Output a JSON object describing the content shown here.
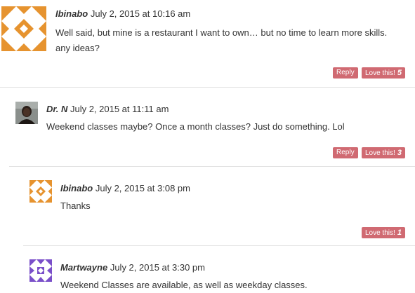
{
  "comments": [
    {
      "author": "Ibinabo",
      "date": "July 2, 2015 at 10:16 am",
      "text": "Well said, but mine is a restaurant I want to own… but no time to learn more skills. any ideas?",
      "reply_label": "Reply",
      "love_label": "Love this!",
      "love_count": "5",
      "avatar_icon": "orange-quilt-avatar-icon"
    },
    {
      "author": "Dr. N",
      "date": "July 2, 2015 at 11:11 am",
      "text": "Weekend classes maybe? Once a month classes? Just do something. Lol",
      "reply_label": "Reply",
      "love_label": "Love this!",
      "love_count": "3",
      "avatar_icon": "photo-avatar-icon"
    },
    {
      "author": "Ibinabo",
      "date": "July 2, 2015 at 3:08 pm",
      "text": "Thanks",
      "love_label": "Love this!",
      "love_count": "1",
      "avatar_icon": "orange-quilt-avatar-icon"
    },
    {
      "author": "Martwayne",
      "date": "July 2, 2015 at 3:30 pm",
      "text": "Weekend Classes are available, as well as weekday classes.",
      "avatar_icon": "purple-quilt-avatar-icon"
    }
  ],
  "colors": {
    "button_bg": "#d06a72",
    "orange_avatar": "#e6932f",
    "purple_avatar": "#7a4fc9",
    "divider": "#e2e2e2"
  }
}
